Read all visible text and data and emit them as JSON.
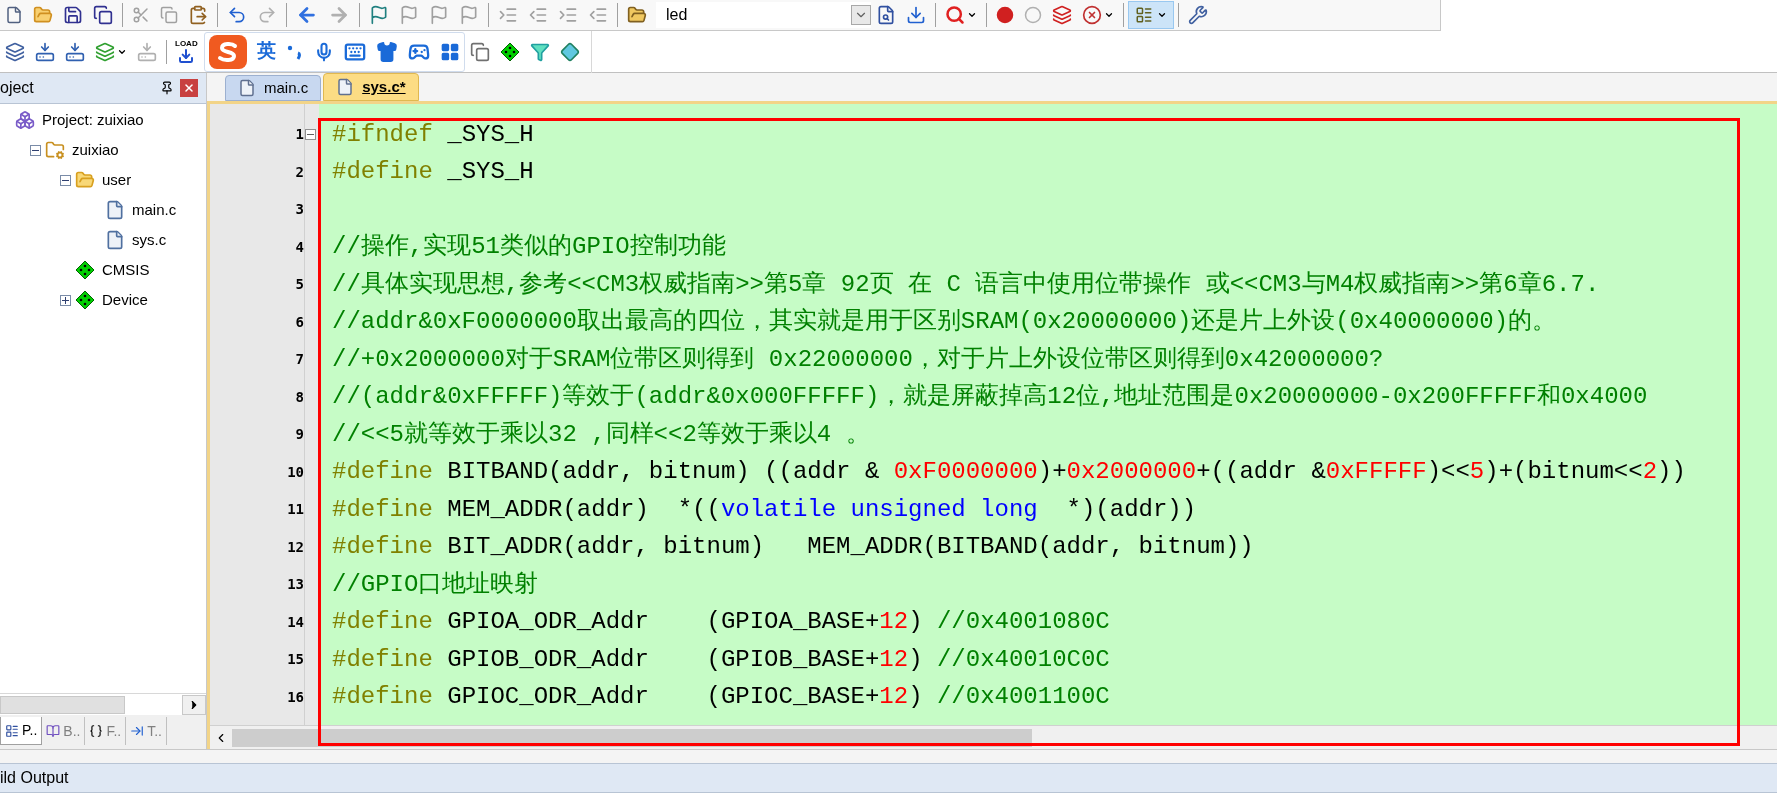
{
  "toolbar": {
    "target": "led",
    "load_label": "LOAD"
  },
  "ime_bar": {
    "language": "英"
  },
  "project_panel": {
    "title": "oject",
    "tree": [
      {
        "label": "Project: zuixiao",
        "kind": "project",
        "children": [
          {
            "label": "zuixiao",
            "kind": "target",
            "expanded": true,
            "children": [
              {
                "label": "user",
                "kind": "group",
                "expanded": true,
                "children": [
                  {
                    "label": "main.c",
                    "kind": "file"
                  },
                  {
                    "label": "sys.c",
                    "kind": "file"
                  }
                ]
              },
              {
                "label": "CMSIS",
                "kind": "component"
              },
              {
                "label": "Device",
                "kind": "component",
                "expanded": false
              }
            ]
          }
        ]
      }
    ],
    "tabs": [
      {
        "label": "P..",
        "kind": "project",
        "selected": true
      },
      {
        "label": "B..",
        "kind": "books",
        "selected": false
      },
      {
        "label": "F..",
        "kind": "functions",
        "selected": false
      },
      {
        "label": "T..",
        "kind": "templates",
        "selected": false
      }
    ]
  },
  "editor": {
    "tabs": [
      {
        "label": "main.c",
        "selected": false
      },
      {
        "label": "sys.c*",
        "selected": true
      }
    ],
    "lines": [
      {
        "number": "1",
        "foldable": true,
        "tokens": [
          {
            "kind": "directive",
            "text": "#ifndef"
          },
          {
            "kind": "plain",
            "text": " _SYS_H"
          }
        ]
      },
      {
        "number": "2",
        "foldable": false,
        "tokens": [
          {
            "kind": "directive",
            "text": "#define"
          },
          {
            "kind": "plain",
            "text": " _SYS_H"
          }
        ]
      },
      {
        "number": "3",
        "foldable": false
      },
      {
        "number": "4",
        "foldable": false,
        "tokens": [
          {
            "kind": "comment",
            "text": "//操作,实现51类似的GPIO控制功能"
          }
        ]
      },
      {
        "number": "5",
        "foldable": false,
        "tokens": [
          {
            "kind": "comment",
            "text": "//具体实现思想,参考<<CM3权威指南>>第5章 92页 在 C 语言中使用位带操作 或<<CM3与M4权威指南>>第6章6.7."
          }
        ]
      },
      {
        "number": "6",
        "foldable": false,
        "tokens": [
          {
            "kind": "comment",
            "text": "//addr&0xF0000000取出最高的四位，其实就是用于区别SRAM(0x20000000)还是片上外设(0x40000000)的。"
          }
        ]
      },
      {
        "number": "7",
        "foldable": false,
        "tokens": [
          {
            "kind": "comment",
            "text": "//+0x2000000对于SRAM位带区则得到 0x22000000，对于片上外设位带区则得到0x42000000?"
          }
        ]
      },
      {
        "number": "8",
        "foldable": false,
        "tokens": [
          {
            "kind": "comment",
            "text": "//(addr&0xFFFFF)等效于(addr&0x000FFFFF)，就是屏蔽掉高12位,地址范围是0x20000000-0x200FFFFF和0x4000"
          }
        ]
      },
      {
        "number": "9",
        "foldable": false,
        "tokens": [
          {
            "kind": "comment",
            "text": "//<<5就等效于乘以32 ,同样<<2等效于乘以4 。"
          }
        ]
      },
      {
        "number": "10",
        "foldable": false,
        "tokens": [
          {
            "kind": "directive",
            "text": "#define"
          },
          {
            "kind": "plain",
            "text": " BITBAND(addr, bitnum) ((addr & "
          },
          {
            "kind": "number",
            "text": "0xF0000000"
          },
          {
            "kind": "plain",
            "text": ")+"
          },
          {
            "kind": "number",
            "text": "0x2000000"
          },
          {
            "kind": "plain",
            "text": "+((addr &"
          },
          {
            "kind": "number",
            "text": "0xFFFFF"
          },
          {
            "kind": "plain",
            "text": ")<<"
          },
          {
            "kind": "number",
            "text": "5"
          },
          {
            "kind": "plain",
            "text": ")+(bitnum<<"
          },
          {
            "kind": "number",
            "text": "2"
          },
          {
            "kind": "plain",
            "text": "))"
          }
        ]
      },
      {
        "number": "11",
        "foldable": false,
        "tokens": [
          {
            "kind": "directive",
            "text": "#define"
          },
          {
            "kind": "plain",
            "text": " MEM_ADDR(addr)  *(("
          },
          {
            "kind": "keyword",
            "text": "volatile unsigned long"
          },
          {
            "kind": "plain",
            "text": "  *)(addr))"
          }
        ]
      },
      {
        "number": "12",
        "foldable": false,
        "tokens": [
          {
            "kind": "directive",
            "text": "#define"
          },
          {
            "kind": "plain",
            "text": " BIT_ADDR(addr, bitnum)   MEM_ADDR(BITBAND(addr, bitnum))"
          }
        ]
      },
      {
        "number": "13",
        "foldable": false,
        "tokens": [
          {
            "kind": "comment",
            "text": "//GPIO口地址映射"
          }
        ]
      },
      {
        "number": "14",
        "foldable": false,
        "tokens": [
          {
            "kind": "directive",
            "text": "#define"
          },
          {
            "kind": "plain",
            "text": " GPIOA_ODR_Addr    (GPIOA_BASE+"
          },
          {
            "kind": "number",
            "text": "12"
          },
          {
            "kind": "plain",
            "text": ") "
          },
          {
            "kind": "comment",
            "text": "//0x4001080C"
          }
        ]
      },
      {
        "number": "15",
        "foldable": false,
        "tokens": [
          {
            "kind": "directive",
            "text": "#define"
          },
          {
            "kind": "plain",
            "text": " GPIOB_ODR_Addr    (GPIOB_BASE+"
          },
          {
            "kind": "number",
            "text": "12"
          },
          {
            "kind": "plain",
            "text": ") "
          },
          {
            "kind": "comment",
            "text": "//0x40010C0C"
          }
        ]
      },
      {
        "number": "16",
        "foldable": false,
        "tokens": [
          {
            "kind": "directive",
            "text": "#define"
          },
          {
            "kind": "plain",
            "text": " GPIOC_ODR_Addr    (GPIOC_BASE+"
          },
          {
            "kind": "number",
            "text": "12"
          },
          {
            "kind": "plain",
            "text": ") "
          },
          {
            "kind": "comment",
            "text": "//0x4001100C"
          }
        ]
      }
    ]
  },
  "highlight": {
    "kind": "frame"
  },
  "output_panel": {
    "title": "ild Output"
  }
}
